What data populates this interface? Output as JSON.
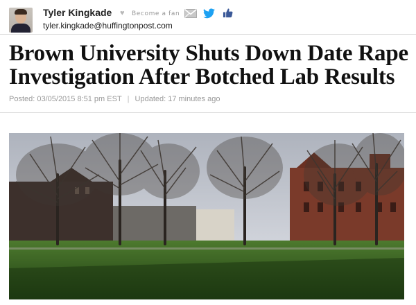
{
  "author": {
    "name": "Tyler Kingkade",
    "become_fan": "Become a fan",
    "email": "tyler.kingkade@huffingtonpost.com"
  },
  "icons": {
    "heart": "heart-icon",
    "mail": "mail-icon",
    "twitter": "twitter-icon",
    "like": "thumbs-up-icon"
  },
  "colors": {
    "twitter": "#1da1f2",
    "like": "#3b5998",
    "meta_text": "#999999"
  },
  "article": {
    "headline": "Brown University Shuts Down Date Rape Investigation After Botched Lab Results",
    "posted": "Posted: 03/05/2015 8:51 pm EST",
    "separator": "|",
    "updated": "Updated: 17 minutes ago"
  }
}
